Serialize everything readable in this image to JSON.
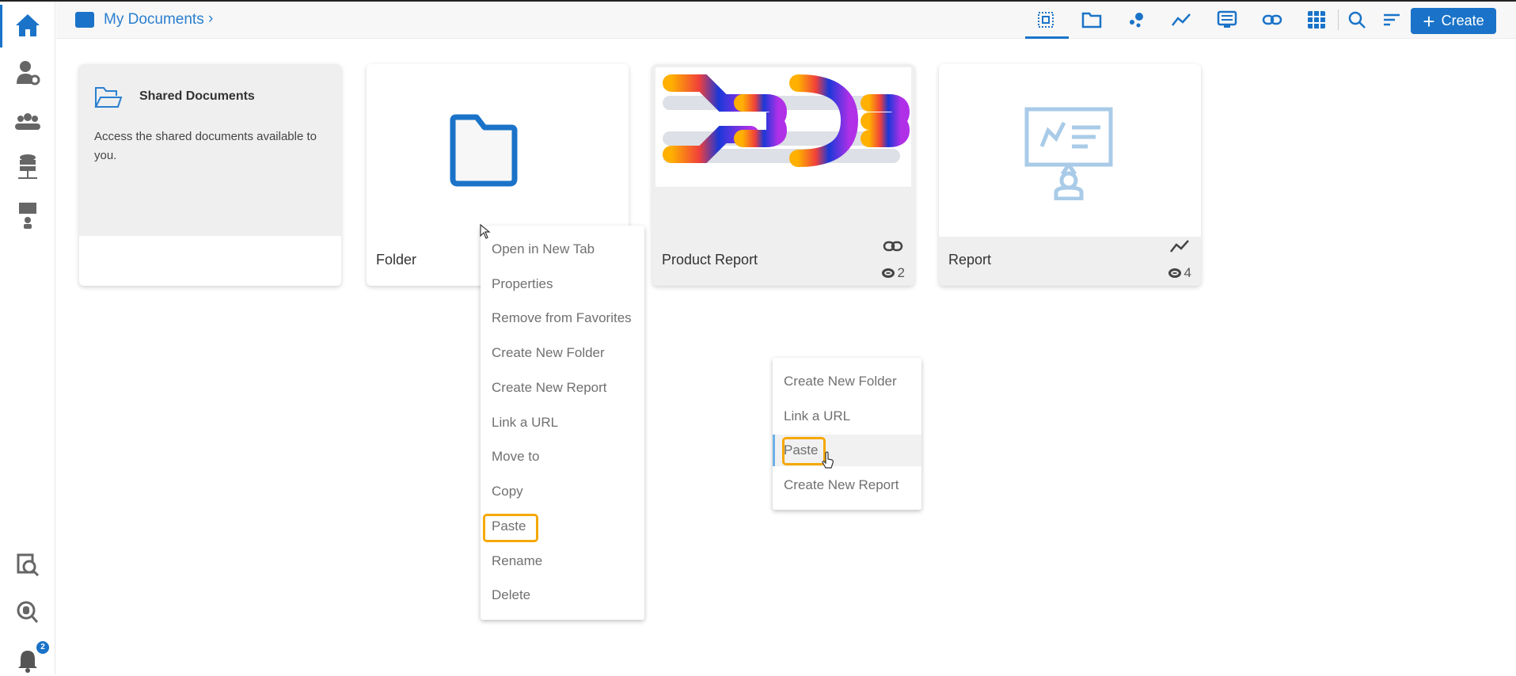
{
  "sidebar": {
    "items": [
      "home-icon",
      "user-settings-icon",
      "users-group-icon",
      "database-network-icon",
      "presentation-icon",
      "data-catalog-search-icon",
      "database-search-icon",
      "notifications-bell-icon"
    ],
    "notification_count": "2"
  },
  "header": {
    "breadcrumb": "My Documents",
    "create_label": "Create",
    "icons": [
      "select-all-icon",
      "folder-icon",
      "scatter-icon",
      "line-chart-icon",
      "dashboard-icon",
      "link-icon",
      "grid-icon",
      "search-icon",
      "sort-icon"
    ]
  },
  "cards": [
    {
      "title": "Shared Documents",
      "description": "Access the shared documents available to you."
    },
    {
      "title": "Folder"
    },
    {
      "title": "Product Report",
      "views": "2"
    },
    {
      "title": "Report",
      "views": "4"
    }
  ],
  "context_menu": [
    "Open in New Tab",
    "Properties",
    "Remove from Favorites",
    "Create New Folder",
    "Create New Report",
    "Link a URL",
    "Move to",
    "Copy",
    "Paste",
    "Rename",
    "Delete"
  ],
  "blank_menu": [
    "Create New Folder",
    "Link a URL",
    "Paste",
    "Create New Report"
  ],
  "colors": {
    "accent": "#1a73c8",
    "highlight": "#f5a800"
  }
}
